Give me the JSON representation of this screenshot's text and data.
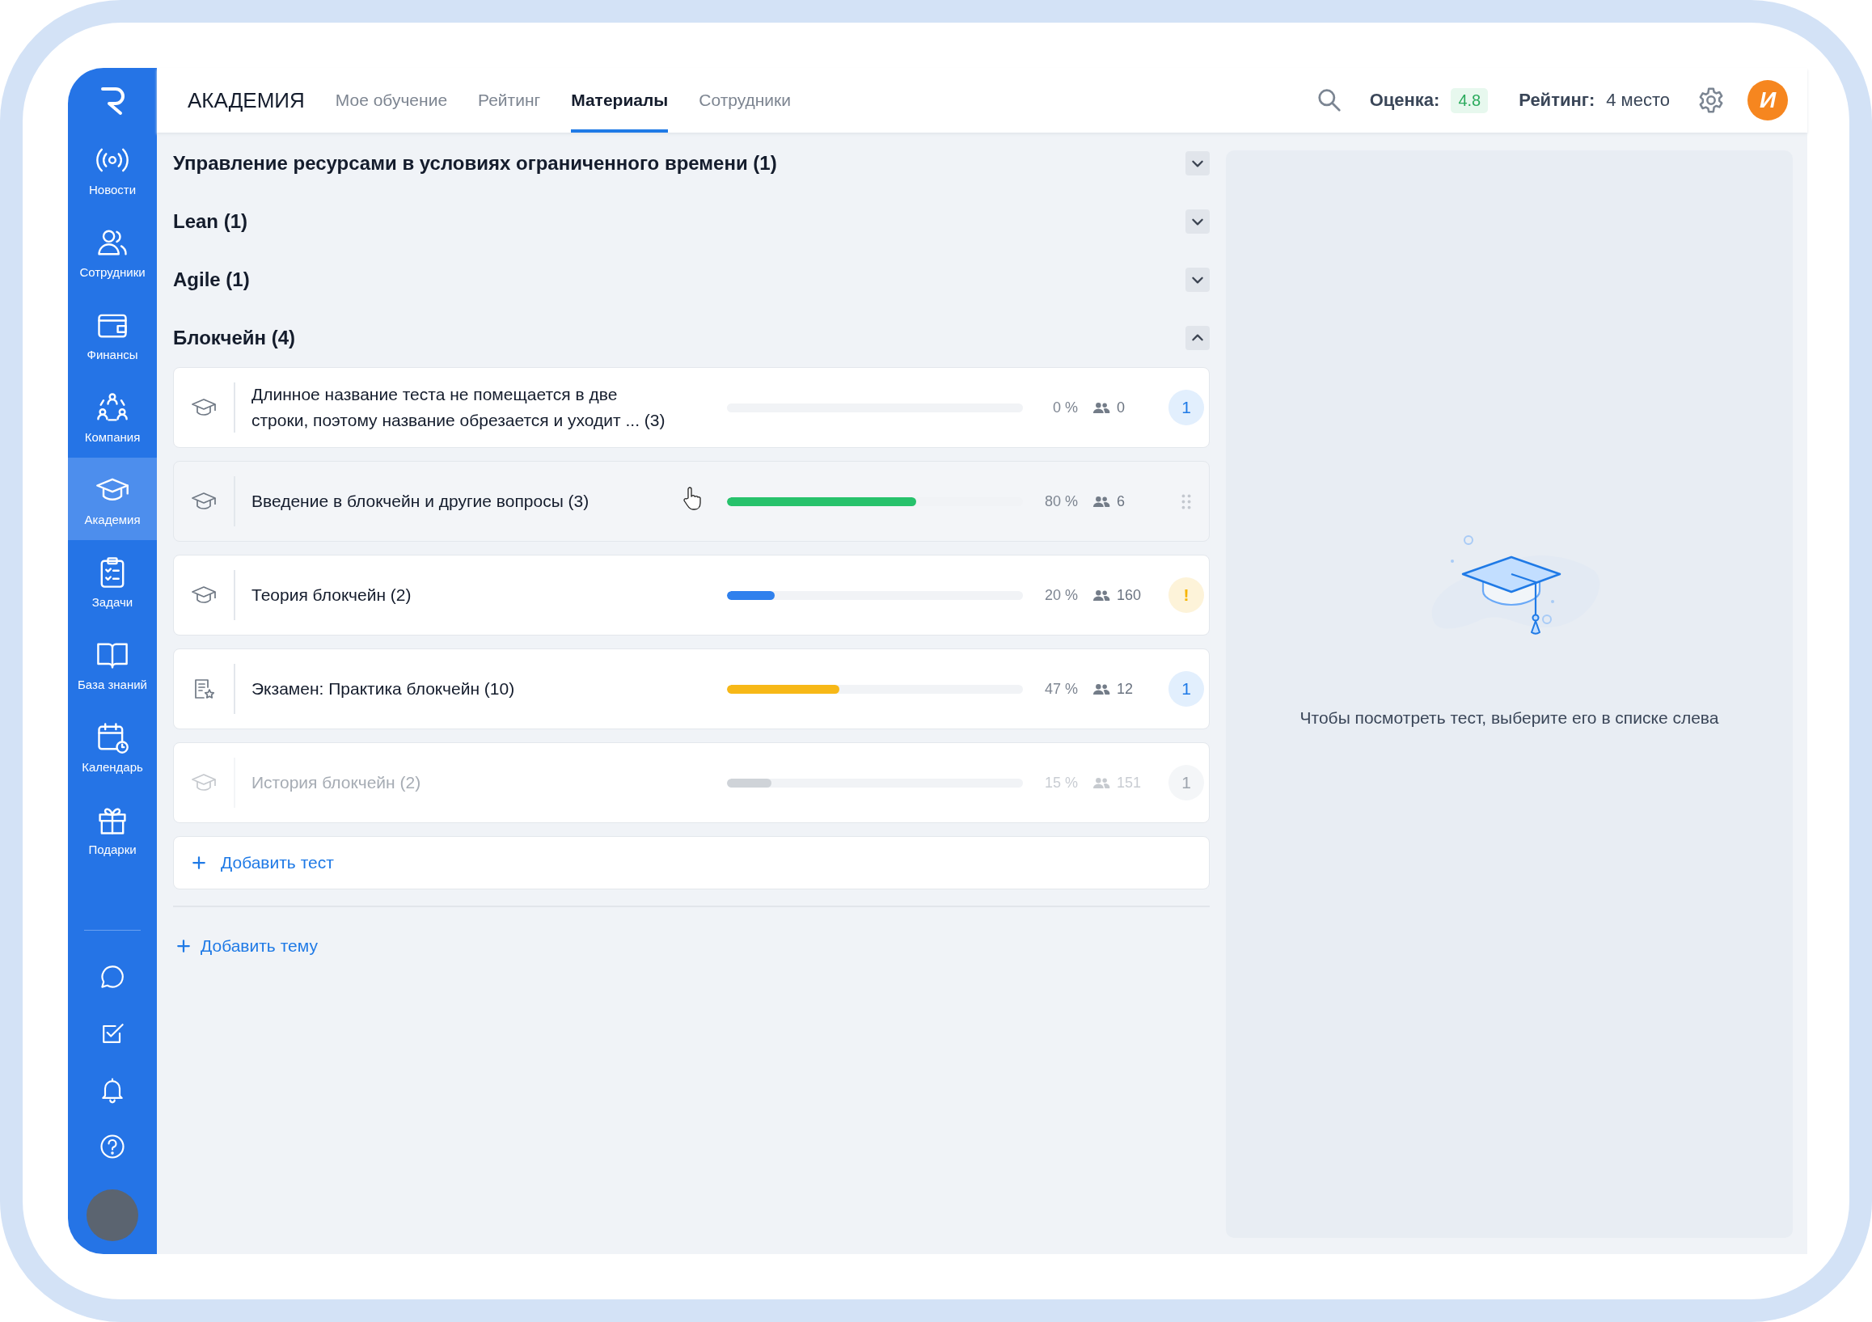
{
  "sidebar": {
    "items": [
      {
        "label": "Новости",
        "kind": "broadcast",
        "selected": false
      },
      {
        "label": "Сотрудники",
        "kind": "people",
        "selected": false
      },
      {
        "label": "Финансы",
        "kind": "wallet",
        "selected": false
      },
      {
        "label": "Компания",
        "kind": "network",
        "selected": false
      },
      {
        "label": "Академия",
        "kind": "cap",
        "selected": true
      },
      {
        "label": "Задачи",
        "kind": "clipboard",
        "selected": false
      },
      {
        "label": "База знаний",
        "kind": "book",
        "selected": false
      },
      {
        "label": "Календарь",
        "kind": "calendar",
        "selected": false
      },
      {
        "label": "Подарки",
        "kind": "gift",
        "selected": false
      }
    ],
    "bottom_actions": [
      {
        "kind": "chat"
      },
      {
        "kind": "check"
      },
      {
        "kind": "bell"
      },
      {
        "kind": "help"
      }
    ]
  },
  "header": {
    "title": "АКАДЕМИЯ",
    "tabs": [
      {
        "label": "Мое обучение",
        "selected": false
      },
      {
        "label": "Рейтинг",
        "selected": false
      },
      {
        "label": "Материалы",
        "selected": true
      },
      {
        "label": "Сотрудники",
        "selected": false
      }
    ],
    "score_label": "Оценка:",
    "score_value": "4.8",
    "rating_label": "Рейтинг:",
    "rating_value": "4 место",
    "avatar_letter": "И"
  },
  "groups": [
    {
      "title": "Управление ресурсами в условиях ограниченного времени (1)",
      "expanded": false
    },
    {
      "title": "Lean (1)",
      "expanded": false
    },
    {
      "title": "Agile (1)",
      "expanded": false
    },
    {
      "title": "Блокчейн (4)",
      "expanded": true,
      "tests": [
        {
          "kind": "course",
          "title": "Длинное название теста не помещается в две строки, поэтому название обрезается и уходит ... (3)",
          "level": 0,
          "percent": "0 %",
          "participants": "0",
          "badge": {
            "kind": "count",
            "text": "1"
          },
          "disabled": false,
          "hovered": false
        },
        {
          "kind": "course",
          "title": "Введение в блокчейн и другие вопросы (3)",
          "level": 0.64,
          "color": "#27c26c",
          "percent": "80 %",
          "participants": "6",
          "badge": {
            "kind": "drag"
          },
          "disabled": false,
          "hovered": true
        },
        {
          "kind": "course",
          "title": "Теория блокчейн (2)",
          "level": 0.16,
          "color": "#2f80ed",
          "percent": "20 %",
          "participants": "160",
          "badge": {
            "kind": "warning",
            "text": "!"
          },
          "disabled": false,
          "hovered": false
        },
        {
          "kind": "exam",
          "title": "Экзамен: Практика блокчейн (10)",
          "level": 0.38,
          "color": "#f7b817",
          "percent": "47 %",
          "participants": "12",
          "badge": {
            "kind": "count",
            "text": "1"
          },
          "disabled": false,
          "hovered": false
        },
        {
          "kind": "course",
          "title": "История блокчейн (2)",
          "level": 0.15,
          "color": "#cfd3d8",
          "percent": "15 %",
          "participants": "151",
          "badge": {
            "kind": "count",
            "text": "1"
          },
          "disabled": true,
          "hovered": false
        }
      ],
      "add_test": "Добавить тест"
    }
  ],
  "add_topic": "Добавить тему",
  "preview": {
    "message": "Чтобы посмотреть тест, выберите его в списке слева"
  }
}
